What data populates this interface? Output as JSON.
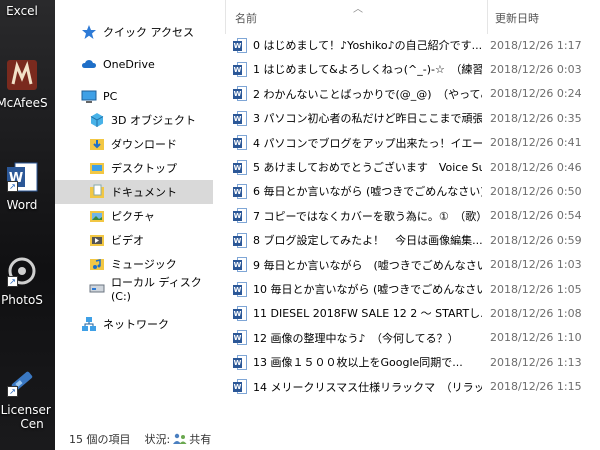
{
  "desktop": {
    "icons": [
      {
        "label": "Excel"
      },
      {
        "label": "McAfeeS"
      },
      {
        "label": "Word"
      },
      {
        "label": "PhotoS"
      },
      {
        "label": "eLicenser"
      },
      {
        "label": "Cen"
      }
    ]
  },
  "nav": {
    "quick_access": "クイック アクセス",
    "onedrive": "OneDrive",
    "pc": "PC",
    "objects3d": "3D オブジェクト",
    "downloads": "ダウンロード",
    "desktop": "デスクトップ",
    "documents": "ドキュメント",
    "pictures": "ピクチャ",
    "videos": "ビデオ",
    "music": "ミュージック",
    "local_disk": "ローカル ディスク (C:)",
    "network": "ネットワーク"
  },
  "columns": {
    "name": "名前",
    "date": "更新日時"
  },
  "files": [
    {
      "name": "0 はじめまして！♪Yoshiko♪の自己紹介です...",
      "date": "2018/12/26 1:17"
    },
    {
      "name": "1 はじめまして&よろしくねっ(^_-)-☆　（練習...",
      "date": "2018/12/26 0:03"
    },
    {
      "name": "2 わかんないことばっかりで(@_@)　（やってみ...",
      "date": "2018/12/26 0:24"
    },
    {
      "name": "3 パソコン初心者の私だけど昨日ここまで頑張...",
      "date": "2018/12/26 0:35"
    },
    {
      "name": "4 パソコンでブログをアップ出来たっ！イエーイ＼...",
      "date": "2018/12/26 0:41"
    },
    {
      "name": "5 あけましておめでとうございます　Voice Sum...",
      "date": "2018/12/26 0:46"
    },
    {
      "name": "6 毎日とか言いながら (嘘つきでごめんなさい)...",
      "date": "2018/12/26 0:50"
    },
    {
      "name": "7 コピーではなくカバーを歌う為に。①　（歌）",
      "date": "2018/12/26 0:54"
    },
    {
      "name": "8 ブログ設定してみたよ！　今日は画像編集...",
      "date": "2018/12/26 0:59"
    },
    {
      "name": "9 毎日とか言いながら　(嘘つきでごめんなさい...",
      "date": "2018/12/26 1:03"
    },
    {
      "name": "10 毎日とか言いながら (嘘つきでごめんなさい)...",
      "date": "2018/12/26 1:05"
    },
    {
      "name": "11 DIESEL 2018FW SALE 12 2 ～ STARTし...",
      "date": "2018/12/26 1:08"
    },
    {
      "name": "12 画像の整理中なう♪　（今何してる？）",
      "date": "2018/12/26 1:10"
    },
    {
      "name": "13 画像１５００枚以上をGoogle同期で...",
      "date": "2018/12/26 1:13"
    },
    {
      "name": "14 メリークリスマス仕様リラックマ　（リラックマ...",
      "date": "2018/12/26 1:15"
    }
  ],
  "status": {
    "count": "15 個の項目",
    "state_label": "状況:",
    "shared": "共有"
  }
}
